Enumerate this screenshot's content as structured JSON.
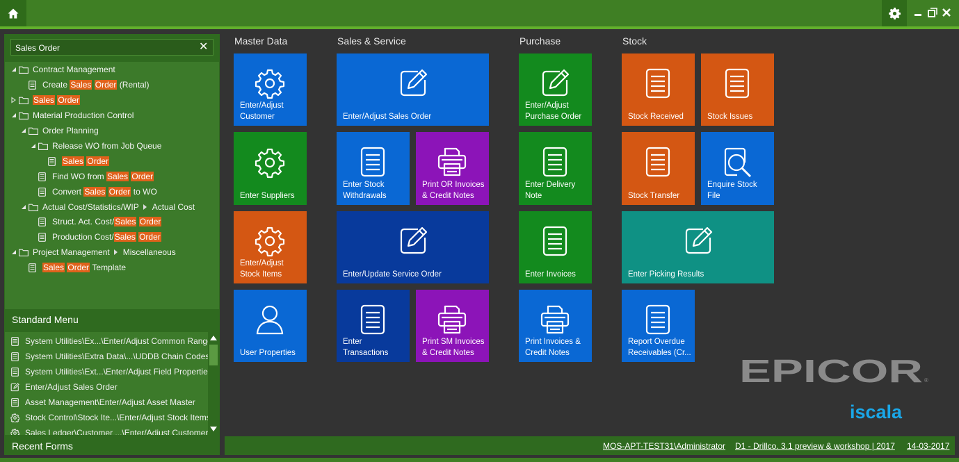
{
  "search": {
    "value": "Sales Order",
    "clear_icon": "close-icon"
  },
  "tree": {
    "contract_management": "Contract Management",
    "create_prefix": "Create",
    "rental_suffix": "(Rental)",
    "sales": "Sales",
    "order": "Order",
    "material_production_control": "Material Production Control",
    "order_planning": "Order Planning",
    "release_wo": "Release WO from Job Queue",
    "find_wo_prefix": "Find WO from",
    "convert_prefix": "Convert",
    "to_wo_suffix": "to WO",
    "actual_cost_stats": "Actual Cost/Statistics/WIP",
    "actual_cost": "Actual Cost",
    "struct_prefix": "Struct. Act. Cost/",
    "production_prefix": "Production Cost/",
    "project_management": "Project Management",
    "miscellaneous": "Miscellaneous",
    "template_suffix": "Template"
  },
  "standard_menu": {
    "title": "Standard Menu",
    "items": [
      {
        "label": "System Utilities\\Ex...\\Enter/Adjust Common Range",
        "icon": "document-icon"
      },
      {
        "label": "System Utilities\\Extra Data\\...\\UDDB Chain Codes",
        "icon": "document-icon"
      },
      {
        "label": "System Utilities\\Ext...\\Enter/Adjust Field Properties",
        "icon": "document-icon"
      },
      {
        "label": "Enter/Adjust Sales Order",
        "icon": "edit-icon"
      },
      {
        "label": "Asset Management\\Enter/Adjust Asset Master",
        "icon": "document-icon"
      },
      {
        "label": "Stock Control\\Stock Ite...\\Enter/Adjust Stock Items",
        "icon": "gear-icon"
      },
      {
        "label": "Sales Ledger\\Customer ...\\Enter/Adjust Customer",
        "icon": "gear-icon"
      }
    ]
  },
  "recent_forms": {
    "title": "Recent Forms"
  },
  "sections": {
    "master_data": "Master Data",
    "sales_service": "Sales & Service",
    "purchase": "Purchase",
    "stock": "Stock"
  },
  "tiles": {
    "customer": "Enter/Adjust\nCustomer",
    "suppliers": "Enter Suppliers",
    "stock_items": "Enter/Adjust\nStock Items",
    "user_properties": "User Properties",
    "sales_order": "Enter/Adjust Sales Order",
    "stock_withdrawals": "Enter Stock\nWithdrawals",
    "print_or": "Print OR Invoices\n& Credit Notes",
    "service_order": "Enter/Update Service Order",
    "transactions": "Enter\nTransactions",
    "print_sm": "Print SM Invoices\n& Credit Notes",
    "purchase_order": "Enter/Adjust\nPurchase Order",
    "delivery_note": "Enter Delivery\nNote",
    "invoices": "Enter Invoices",
    "print_invoices": "Print Invoices &\nCredit Notes",
    "stock_received": "Stock Received",
    "stock_issues": "Stock Issues",
    "stock_transfer": "Stock Transfer",
    "enquire_stock": "Enquire Stock\nFile",
    "picking_results": "Enter Picking Results",
    "overdue_receivables": "Report Overdue\nReceivables (Cr..."
  },
  "logos": {
    "epicor": "EPICOR",
    "iscala": "iscala"
  },
  "status": {
    "user": "MOS-APT-TEST31\\Administrator",
    "company": "D1 - Drillco. 3.1 preview & workshop | 2017",
    "date": "14-03-2017"
  },
  "colors": {
    "accent_green": "#3f7f24",
    "tile_blue": "#0a68d4",
    "tile_dark_blue": "#083a9c",
    "tile_green": "#138a1e",
    "tile_orange": "#d45713",
    "tile_purple": "#8c14b8",
    "tile_teal": "#0f9184",
    "highlight": "#e0621b"
  }
}
